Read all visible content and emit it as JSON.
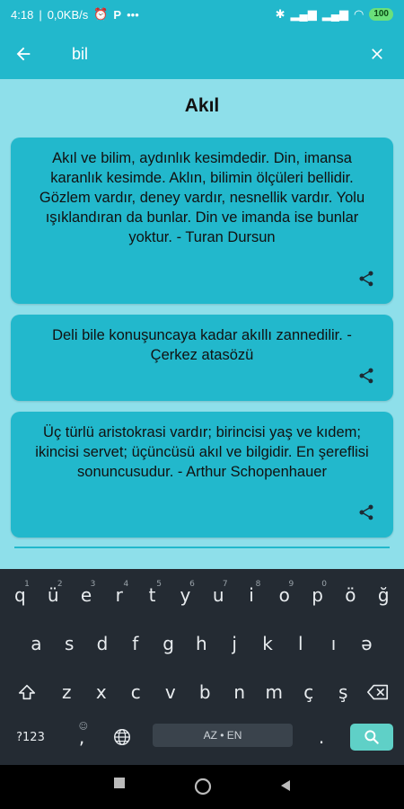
{
  "status": {
    "time": "4:18",
    "speed": "0,0KB/s",
    "battery": "100"
  },
  "search": {
    "query": "bil"
  },
  "category_title": "Akıl",
  "quotes": [
    {
      "text": "Akıl ve bilim, aydınlık kesimdedir. Din, imansa karanlık kesimde. Aklın, bilimin ölçüleri bellidir. Gözlem vardır, deney vardır, nesnellik vardır. Yolu ışıklandıran da bunlar. Din ve imanda ise bunlar yoktur. - Turan Dursun"
    },
    {
      "text": "Deli bile konuşuncaya kadar akıllı zannedilir. - Çerkez atasözü"
    },
    {
      "text": "Üç türlü aristokrasi vardır; birincisi yaş ve kıdem; ikincisi servet; üçüncüsü akıl ve bilgidir. En şereflisi sonuncusudur. - Arthur Schopenhauer"
    }
  ],
  "keyboard": {
    "row1": [
      "q",
      "ü",
      "e",
      "r",
      "t",
      "y",
      "u",
      "i",
      "o",
      "p",
      "ö",
      "ğ"
    ],
    "row1_hints": [
      "1",
      "2",
      "3",
      "4",
      "5",
      "6",
      "7",
      "8",
      "9",
      "0",
      "",
      ""
    ],
    "row2": [
      "a",
      "s",
      "d",
      "f",
      "g",
      "h",
      "j",
      "k",
      "l",
      "ı",
      "ə"
    ],
    "row3": [
      "z",
      "x",
      "c",
      "v",
      "b",
      "n",
      "m",
      "ç",
      "ş"
    ],
    "symbols_key": "?123",
    "comma_key": ",",
    "space_label": "AZ • EN",
    "period_key": "."
  }
}
